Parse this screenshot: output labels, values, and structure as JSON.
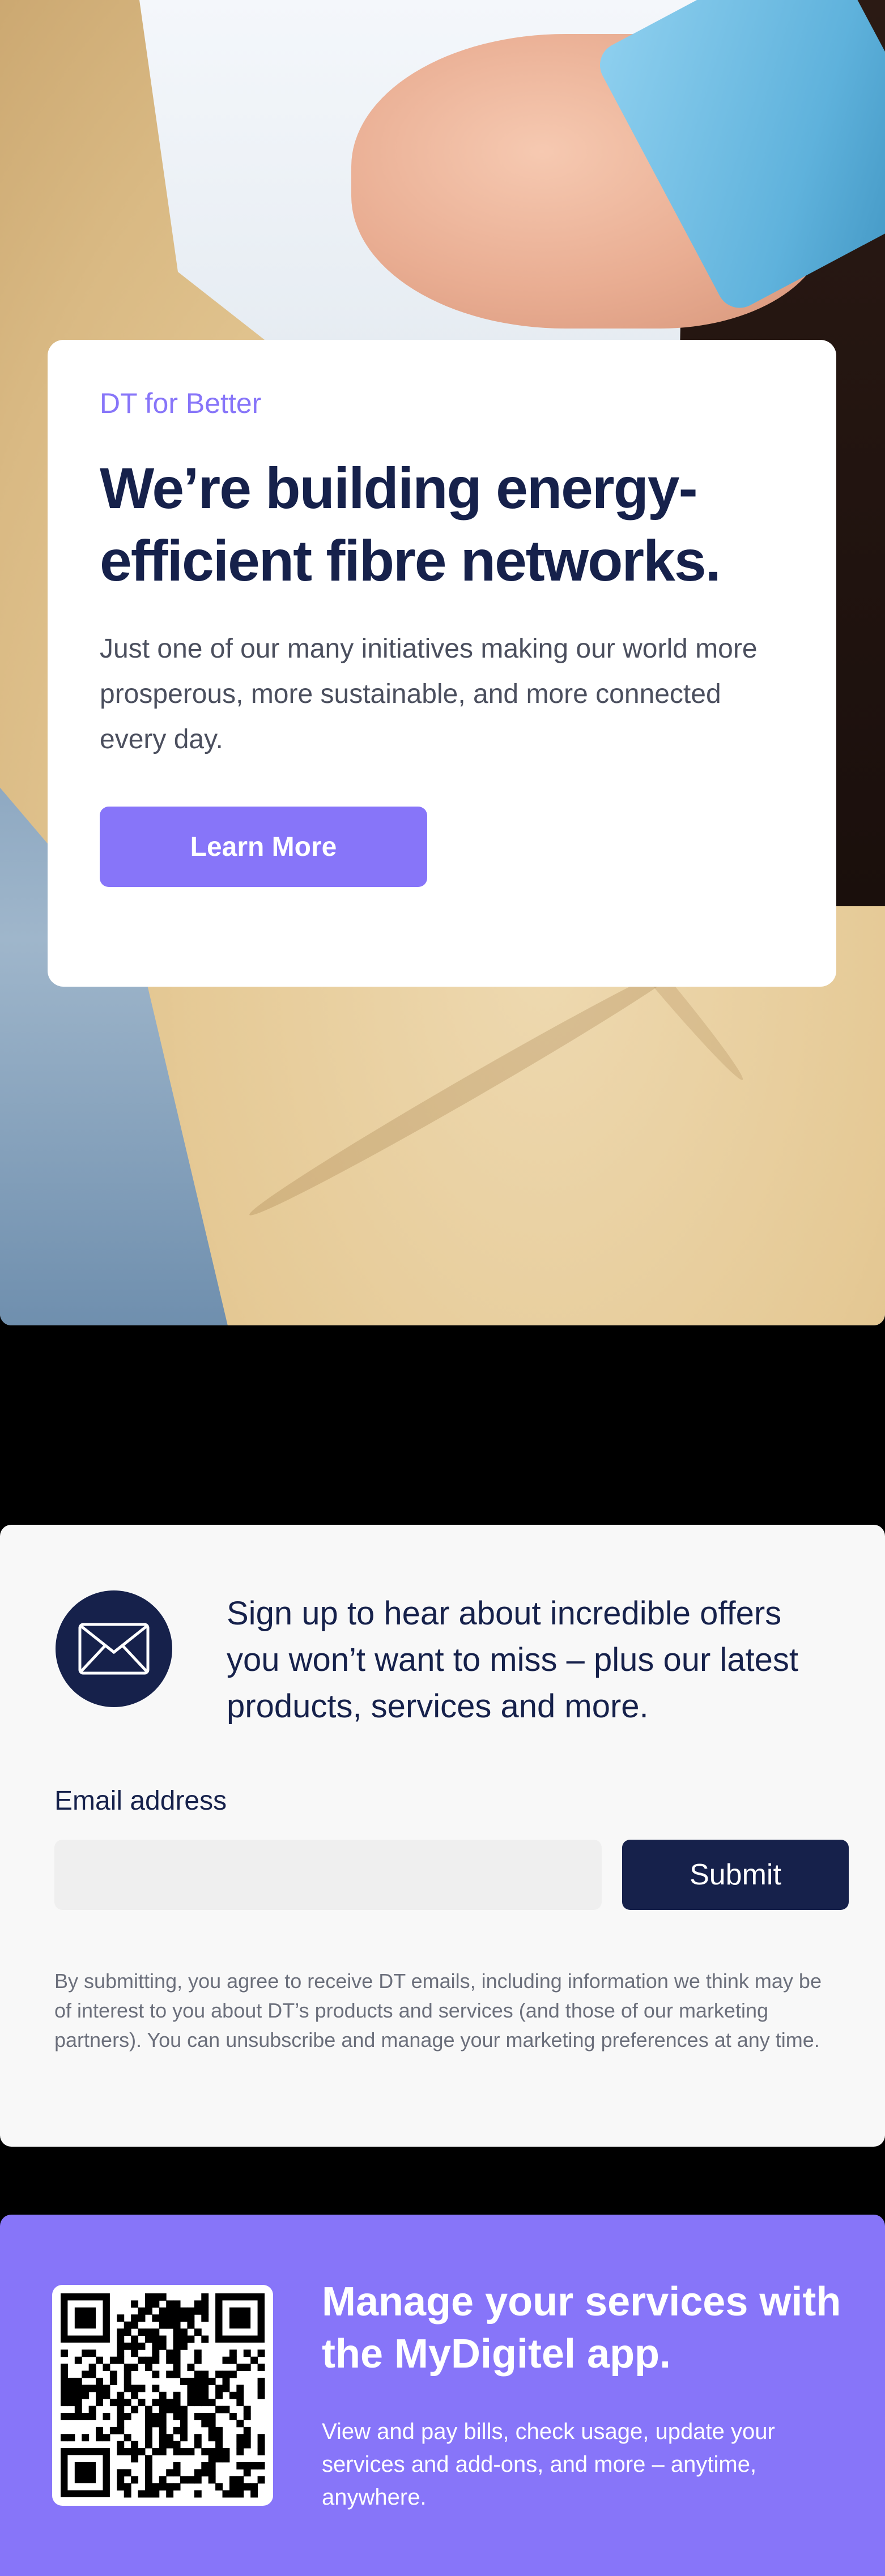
{
  "hero": {
    "eyebrow": "DT for Better",
    "headline": "We’re building energy-efficient fibre networks.",
    "lead": "Just one of our many initiatives making our world more prosperous, more sustainable, and more connected every day.",
    "cta_label": "Learn More",
    "accent_color": "#8775f9",
    "headline_color": "#16214b"
  },
  "signup": {
    "icon": "envelope-icon",
    "message": "Sign up to hear about incredible offers you won’t want to miss – plus our latest products, services and more.",
    "email_label": "Email address",
    "email_value": "",
    "email_placeholder": "",
    "submit_label": "Submit",
    "disclaimer": "By submitting, you agree to receive DT emails, including information we think may be of interest to you about DT’s products and services (and those of our marketing partners). You can unsubscribe and manage your marketing preferences at any time."
  },
  "app": {
    "qr_icon": "qr-code-icon",
    "title": "Manage your services with the MyDigitel app.",
    "description": "View and pay bills, check usage, update your services and add-ons, and more – anytime, anywhere.",
    "background_color": "#8775f9"
  }
}
